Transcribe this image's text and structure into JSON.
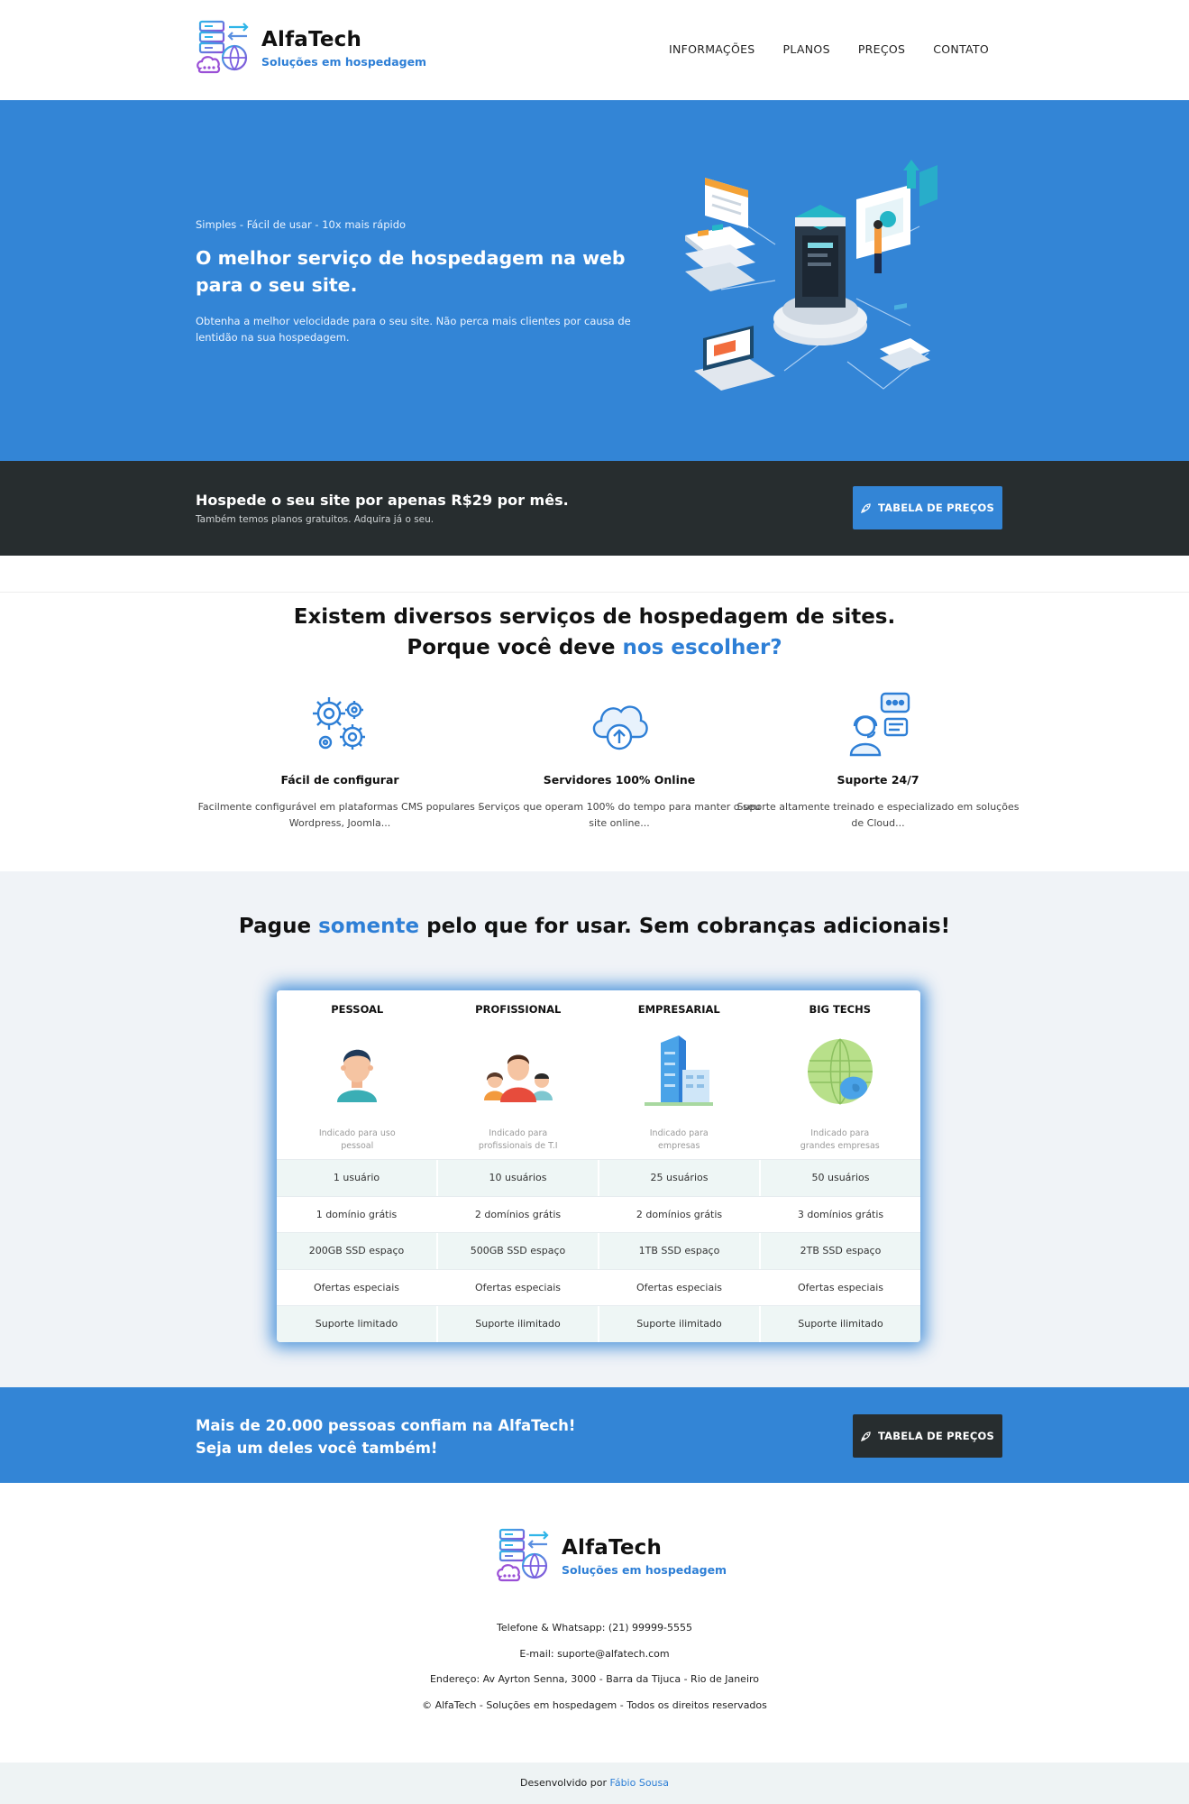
{
  "brand": {
    "name": "AlfaTech",
    "tagline": "Soluções em hospedagem"
  },
  "nav": {
    "items": [
      {
        "label": "INFORMAÇÕES"
      },
      {
        "label": "PLANOS"
      },
      {
        "label": "PREÇOS"
      },
      {
        "label": "CONTATO"
      }
    ]
  },
  "hero": {
    "tagline": "Simples - Fácil de usar - 10x mais rápido",
    "title": "O melhor serviço de hospedagem na web para o seu site.",
    "description": "Obtenha a melhor velocidade para o seu site. Não perca mais clientes por causa de lentidão na sua hospedagem."
  },
  "cta_dark": {
    "title": "Hospede o seu site por apenas R$29 por mês.",
    "subtitle": "Também temos planos gratuitos. Adquira já o seu.",
    "button_label": "TABELA DE PREÇOS"
  },
  "why": {
    "title_line1": "Existem diversos serviços de hospedagem de sites.",
    "title_line2_prefix": "Porque você deve ",
    "title_line2_highlight": "nos escolher?",
    "features": [
      {
        "icon": "gears-icon",
        "title": "Fácil de configurar",
        "description": "Facilmente configurável em plataformas CMS populares - Wordpress, Joomla..."
      },
      {
        "icon": "cloud-upload-icon",
        "title": "Servidores 100% Online",
        "description": "Serviços que operam 100% do tempo para manter o seu site online..."
      },
      {
        "icon": "support-agent-icon",
        "title": "Suporte 24/7",
        "description": "Suporte altamente treinado e especializado em soluções de Cloud..."
      }
    ]
  },
  "pricing": {
    "title_prefix": "Pague ",
    "title_highlight": "somente",
    "title_suffix": " pelo que for usar. Sem cobranças adicionais!",
    "plans": [
      {
        "name": "PESSOAL",
        "icon": "person-avatar-icon",
        "hint": "Indicado para uso pessoal",
        "users": "1 usuário",
        "domains": "1 domínio grátis",
        "storage": "200GB SSD espaço",
        "offers": "Ofertas especiais",
        "support": "Suporte limitado"
      },
      {
        "name": "PROFISSIONAL",
        "icon": "team-icon",
        "hint": "Indicado para profissionais de T.I",
        "users": "10 usuários",
        "domains": "2 domínios grátis",
        "storage": "500GB SSD espaço",
        "offers": "Ofertas especiais",
        "support": "Suporte ilimitado"
      },
      {
        "name": "EMPRESARIAL",
        "icon": "building-icon",
        "hint": "Indicado para empresas",
        "users": "25 usuários",
        "domains": "2 domínios grátis",
        "storage": "1TB SSD espaço",
        "offers": "Ofertas especiais",
        "support": "Suporte ilimitado"
      },
      {
        "name": "BIG TECHS",
        "icon": "globe-icon",
        "hint": "Indicado para grandes empresas",
        "users": "50 usuários",
        "domains": "3 domínios grátis",
        "storage": "2TB SSD espaço",
        "offers": "Ofertas especiais",
        "support": "Suporte ilimitado"
      }
    ]
  },
  "cta_blue": {
    "line1": "Mais de 20.000 pessoas confiam na AlfaTech!",
    "line2": "Seja um deles você também!",
    "button_label": "TABELA DE PREÇOS"
  },
  "footer": {
    "phone": "Telefone & Whatsapp: (21) 99999-5555",
    "email": "E-mail: suporte@alfatech.com",
    "address": "Endereço: Av Ayrton Senna, 3000 - Barra da Tijuca - Rio de Janeiro",
    "copyright": "© AlfaTech - Soluções em hospedagem - Todos os direitos reservados",
    "credit_prefix": "Desenvolvido por ",
    "credit_author": "Fábio Sousa"
  },
  "colors": {
    "primary": "#3385d6",
    "dark": "#272d2f",
    "pricing_bg": "#f0f3f7"
  }
}
